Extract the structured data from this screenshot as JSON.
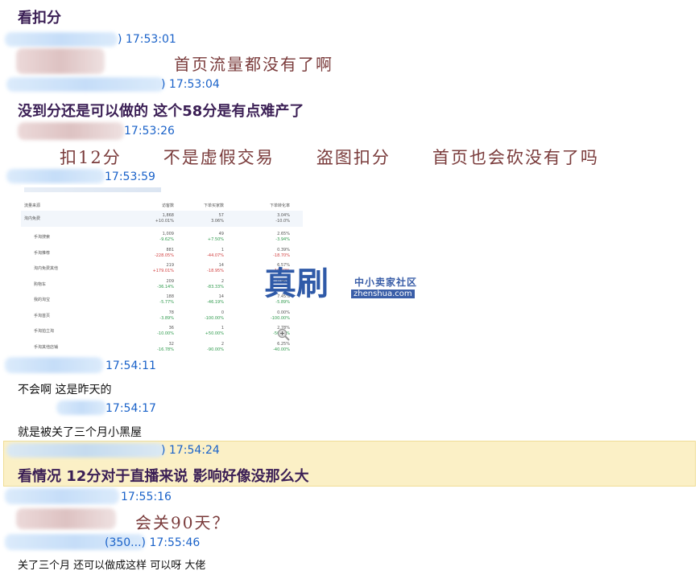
{
  "messages": [
    {
      "text": "看扣分"
    },
    {
      "time": ") 17:53:01",
      "text": "首页流量都没有了啊"
    },
    {
      "time": ") 17:53:04",
      "text": "没到分还是可以做的  这个58分是有点难产了"
    },
    {
      "time": "17:53:26",
      "text": "扣12分      不是虚假交易      盗图扣分      首页也会砍没有了吗"
    },
    {
      "time": "17:53:59"
    },
    {
      "time": "17:54:11",
      "text": "不会啊 这是昨天的"
    },
    {
      "time": "17:54:17",
      "text": "就是被关了三个月小黑屋"
    },
    {
      "time": ") 17:54:24",
      "text": "看情况 12分对于直播来说 影响好像没那么大"
    },
    {
      "time": "17:55:16",
      "text": "会关90天？"
    },
    {
      "time": "(350...) 17:55:46",
      "text": "关了三个月 还可以做成这样 可以呀 大佬"
    }
  ],
  "embedded_table": {
    "header_rows": [
      {
        "label": "流量来源",
        "c2": "访客数",
        "c3": "下单买家数",
        "c4": "下单转化率"
      },
      {
        "label": "淘内免费",
        "c2": "1,868",
        "c2b": "+10.01%",
        "c3": "57",
        "c3b": "3.06%",
        "c4": "3.04%",
        "c4b": "-10.0%"
      }
    ],
    "rows": [
      {
        "label": "手淘搜索",
        "c2": "1,009",
        "c2b": "-9.62%",
        "c3": "49",
        "c3b": "+7.50%",
        "c4": "2.65%",
        "c4b": "-3.94%",
        "tone": "green"
      },
      {
        "label": "手淘推荐",
        "c2": "881",
        "c2b": "-228.05%",
        "c3": "1",
        "c3b": "-44.07%",
        "c4": "0.39%",
        "c4b": "-18.70%",
        "tone": "red"
      },
      {
        "label": "淘内免费其他",
        "c2": "219",
        "c2b": "+179.01%",
        "c3": "14",
        "c3b": "-18.95%",
        "c4": "6.57%",
        "c4b": "-16.82%",
        "tone": "red"
      },
      {
        "label": "购物车",
        "c2": "209",
        "c2b": "-36.14%",
        "c3": "2",
        "c3b": "-83.33%",
        "c4": "0.96%",
        "c4b": "",
        "tone": "green"
      },
      {
        "label": "我的淘宝",
        "c2": "188",
        "c2b": "-5.77%",
        "c3": "14",
        "c3b": "-46.19%",
        "c4": "7.45%",
        "c4b": "-5.89%",
        "tone": "green"
      },
      {
        "label": "手淘首页",
        "c2": "78",
        "c2b": "-3.89%",
        "c3": "0",
        "c3b": "-100.00%",
        "c4": "0.00%",
        "c4b": "-100.00%",
        "tone": "green"
      },
      {
        "label": "手淘拍立淘",
        "c2": "36",
        "c2b": "-10.00%",
        "c3": "1",
        "c3b": "+50.00%",
        "c4": "2.78%",
        "c4b": "-50.00%",
        "tone": "green"
      },
      {
        "label": "手淘其他店铺",
        "c2": "32",
        "c2b": "-16.78%",
        "c3": "2",
        "c3b": "-90.00%",
        "c4": "6.25%",
        "c4b": "-40.00%",
        "tone": "green"
      }
    ]
  },
  "watermark": {
    "main": "真刷",
    "side": "中小卖家社区",
    "url": "zhenshua.com"
  }
}
